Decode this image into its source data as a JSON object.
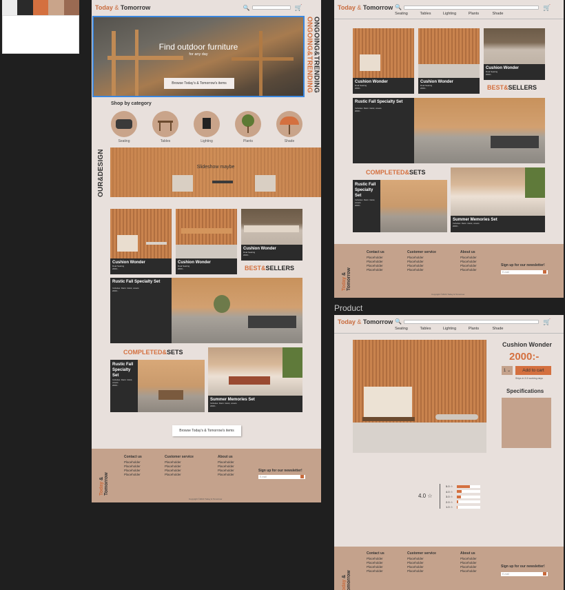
{
  "palette": [
    "#ececec",
    "#2a2a2a",
    "#d4703f",
    "#c9a48a",
    "#9a6a52"
  ],
  "brand": {
    "today": "Today",
    "amp": "&",
    "tomorrow": "Tomorrow"
  },
  "nav": [
    "Seating",
    "Tables",
    "Lighting",
    "Plants",
    "Shade"
  ],
  "hero": {
    "title": "Find outdoor furniture",
    "subtitle": "for any day",
    "button": "Browse Today's & Tomorrow's items"
  },
  "side_text": {
    "ongoing": "ONGOING&TRENDING",
    "ongoing2": "ONGOING&TRENDING",
    "our_design": "OUR&DESIGN"
  },
  "category": {
    "title": "Shop by category",
    "items": [
      "Seating",
      "Tables",
      "Lighting",
      "Plants",
      "Shade"
    ]
  },
  "slideshow": "Slideshow maybe",
  "products": [
    {
      "name": "Cushion Wonder",
      "desc": "Dual Seating",
      "price": "2000:-"
    },
    {
      "name": "Cushion Wonder",
      "desc": "Dual Seating",
      "price": "2000:-"
    },
    {
      "name": "Cushion Wonder",
      "desc": "Dual Seating",
      "price": "2000:-"
    }
  ],
  "bestsellers": {
    "best": "BEST",
    "amp": "&",
    "sellers": "SELLERS"
  },
  "fall_set": {
    "name": "Rustic Fall Specialty Set",
    "desc": "Includes: Darm röstol, vosets",
    "price": "2000:-"
  },
  "completed": {
    "completed": "COMPLETED",
    "amp": "&",
    "sets": "SETS"
  },
  "set_fall": {
    "name": "Rustic Fall Specialty Set",
    "desc": "Includes: Darm röstol, vosets",
    "price": "2000:-"
  },
  "set_summer": {
    "name": "Summer Memories Set",
    "desc": "Includes: Darm röstol, vosets",
    "price": "2000:-"
  },
  "browse_btn": "Browse Today's & Tomorrow's items",
  "footer": {
    "contact": "Contact us",
    "service": "Customer service",
    "about": "About us",
    "placeholder": "Placeholder",
    "newsletter": "Sign up for our newsletter!",
    "email": "E-mail",
    "copyright": "Copyright ©2024 Today & Tomorrow"
  },
  "frame_label": "Product",
  "product_page": {
    "name": "Cushion Wonder",
    "price": "2000:-",
    "qty": "1",
    "add_to_cart": "Add to cart",
    "shipping": "Ships in 3-5 working days",
    "specs": "Specifications",
    "rating": "4.0 ☆",
    "ratings": [
      {
        "label": "5.0 ☆",
        "fill": 0.55
      },
      {
        "label": "4.0 ☆",
        "fill": 0.2
      },
      {
        "label": "3.0 ☆",
        "fill": 0.18
      },
      {
        "label": "2.0 ☆",
        "fill": 0.06
      },
      {
        "label": "1.0 ☆",
        "fill": 0.04
      }
    ]
  }
}
